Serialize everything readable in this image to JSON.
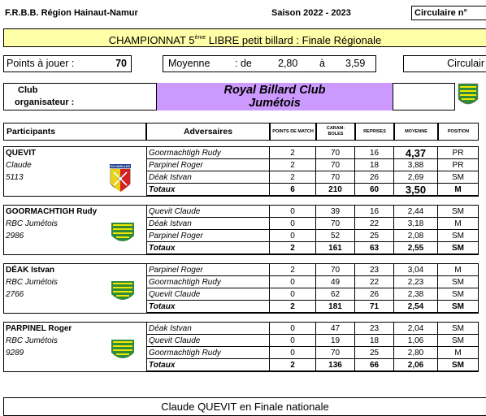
{
  "header": {
    "federation": "F.R.B.B.  Région Hainaut-Namur",
    "season": "Saison 2022 - 2023",
    "circular": "Circulaire n°"
  },
  "banner": {
    "title_pre": "CHAMPIONNAT 5",
    "title_sup": "ème",
    "title_post": " LIBRE petit billard : Finale Régionale"
  },
  "info": {
    "points_label": "Points à jouer :",
    "points_value": "70",
    "average_label": "Moyenne",
    "average_from": ":   de",
    "average_min": "2,80",
    "average_to": "à",
    "average_max": "3,59",
    "circular2": "Circulair"
  },
  "club": {
    "label_line1": "Club",
    "label_line2": "organisateur :",
    "name_line1": "Royal Billard Club",
    "name_line2": "Jumétois"
  },
  "columns": {
    "participants": "Participants",
    "opponents": "Adversaires",
    "points": "POINTS DE MATCH",
    "caramboles": "CARAM-BOLES",
    "reprises": "REPRISES",
    "moyenne": "MOYENNE",
    "position": "POSITION"
  },
  "players": [
    {
      "name": "QUEVIT",
      "first": "Claude",
      "number": "5113",
      "badge": "RC NIVELLES",
      "games": [
        {
          "opp": "Goormachtigh Rudy",
          "pts": "2",
          "car": "70",
          "rep": "16",
          "moy": "4,37",
          "pos": "PR",
          "big": true
        },
        {
          "opp": "Parpinel Roger",
          "pts": "2",
          "car": "70",
          "rep": "18",
          "moy": "3,88",
          "pos": "PR"
        },
        {
          "opp": "Déak Istvan",
          "pts": "2",
          "car": "70",
          "rep": "26",
          "moy": "2,69",
          "pos": "SM"
        }
      ],
      "total": {
        "label": "Totaux",
        "pts": "6",
        "car": "210",
        "rep": "60",
        "moy": "3,50",
        "pos": "M",
        "big": true
      }
    },
    {
      "name": "GOORMACHTIGH Rudy",
      "first": "RBC Jumétois",
      "number": "2986",
      "games": [
        {
          "opp": "Quevit Claude",
          "pts": "0",
          "car": "39",
          "rep": "16",
          "moy": "2,44",
          "pos": "SM"
        },
        {
          "opp": "Déak Istvan",
          "pts": "0",
          "car": "70",
          "rep": "22",
          "moy": "3,18",
          "pos": "M"
        },
        {
          "opp": "Parpinel Roger",
          "pts": "0",
          "car": "52",
          "rep": "25",
          "moy": "2,08",
          "pos": "SM"
        }
      ],
      "total": {
        "label": "Totaux",
        "pts": "2",
        "car": "161",
        "rep": "63",
        "moy": "2,55",
        "pos": "SM"
      }
    },
    {
      "name": "DÉAK Istvan",
      "first": "RBC Jumétois",
      "number": "2766",
      "games": [
        {
          "opp": "Parpinel Roger",
          "pts": "2",
          "car": "70",
          "rep": "23",
          "moy": "3,04",
          "pos": "M"
        },
        {
          "opp": "Goormachtigh Rudy",
          "pts": "0",
          "car": "49",
          "rep": "22",
          "moy": "2,23",
          "pos": "SM"
        },
        {
          "opp": "Quevit Claude",
          "pts": "0",
          "car": "62",
          "rep": "26",
          "moy": "2,38",
          "pos": "SM"
        }
      ],
      "total": {
        "label": "Totaux",
        "pts": "2",
        "car": "181",
        "rep": "71",
        "moy": "2,54",
        "pos": "SM"
      }
    },
    {
      "name": "PARPINEL Roger",
      "first": "RBC Jumétois",
      "number": "9289",
      "games": [
        {
          "opp": "Déak Istvan",
          "pts": "0",
          "car": "47",
          "rep": "23",
          "moy": "2,04",
          "pos": "SM"
        },
        {
          "opp": "Quevit Claude",
          "pts": "0",
          "car": "19",
          "rep": "18",
          "moy": "1,06",
          "pos": "SM"
        },
        {
          "opp": "Goormachtigh Rudy",
          "pts": "0",
          "car": "70",
          "rep": "25",
          "moy": "2,80",
          "pos": "M"
        }
      ],
      "total": {
        "label": "Totaux",
        "pts": "2",
        "car": "136",
        "rep": "66",
        "moy": "2,06",
        "pos": "SM"
      }
    }
  ],
  "footer": "Claude QUEVIT en Finale nationale",
  "colors": {
    "banner_bg": "#ffffa8",
    "club_bg": "#cc99ff",
    "logo_green": "#2e8b3a",
    "logo_yellow": "#f2e600"
  }
}
